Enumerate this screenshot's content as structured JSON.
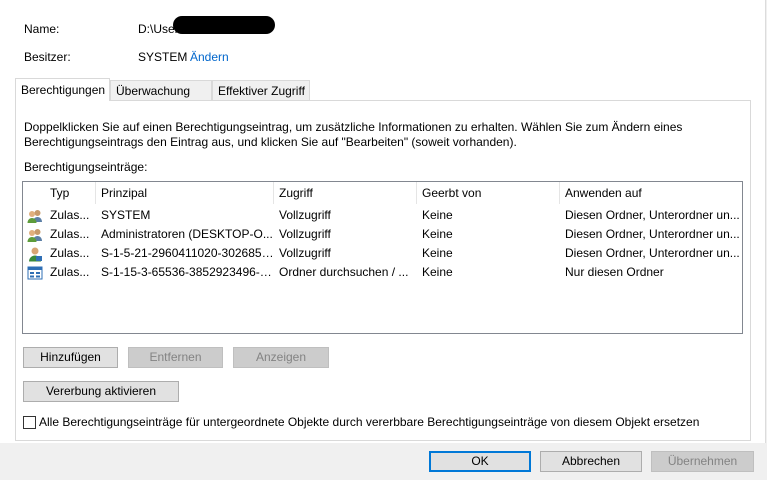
{
  "header": {
    "name_label": "Name:",
    "name_value": "D:\\Users",
    "owner_label": "Besitzer:",
    "owner_value": "SYSTEM",
    "owner_change_link": "Ändern"
  },
  "tabs": [
    {
      "label": "Berechtigungen",
      "active": true
    },
    {
      "label": "Überwachung",
      "active": false
    },
    {
      "label": "Effektiver Zugriff",
      "active": false
    }
  ],
  "permissions": {
    "info_text": "Doppelklicken Sie auf einen Berechtigungseintrag, um zusätzliche Informationen zu erhalten. Wählen Sie zum Ändern eines Berechtigungseintrags den Eintrag aus, und klicken Sie auf \"Bearbeiten\" (soweit vorhanden).",
    "entries_label": "Berechtigungseinträge:",
    "columns": [
      "Typ",
      "Prinzipal",
      "Zugriff",
      "Geerbt von",
      "Anwenden auf"
    ],
    "rows": [
      {
        "icon": "user-group-icon",
        "type": "Zulas...",
        "principal": "SYSTEM",
        "access": "Vollzugriff",
        "inherited": "Keine",
        "applies": "Diesen Ordner, Unterordner un..."
      },
      {
        "icon": "user-group-icon",
        "type": "Zulas...",
        "principal": "Administratoren (DESKTOP-O...",
        "access": "Vollzugriff",
        "inherited": "Keine",
        "applies": "Diesen Ordner, Unterordner un..."
      },
      {
        "icon": "user-icon",
        "type": "Zulas...",
        "principal": "S-1-5-21-2960411020-3026850...",
        "access": "Vollzugriff",
        "inherited": "Keine",
        "applies": "Diesen Ordner, Unterordner un..."
      },
      {
        "icon": "app-package-icon",
        "type": "Zulas...",
        "principal": "S-1-15-3-65536-3852923496-3...",
        "access": "Ordner durchsuchen / ...",
        "inherited": "Keine",
        "applies": "Nur diesen Ordner"
      }
    ],
    "buttons": {
      "add": "Hinzufügen",
      "remove": "Entfernen",
      "view": "Anzeigen",
      "enable_inheritance": "Vererbung aktivieren"
    },
    "replace_checkbox_label": "Alle Berechtigungseinträge für untergeordnete Objekte durch vererbbare Berechtigungseinträge von diesem Objekt ersetzen",
    "replace_checkbox_checked": false
  },
  "footer": {
    "ok": "OK",
    "cancel": "Abbrechen",
    "apply": "Übernehmen"
  },
  "colors": {
    "link": "#0066cc",
    "default_button_border": "#0078d7"
  }
}
